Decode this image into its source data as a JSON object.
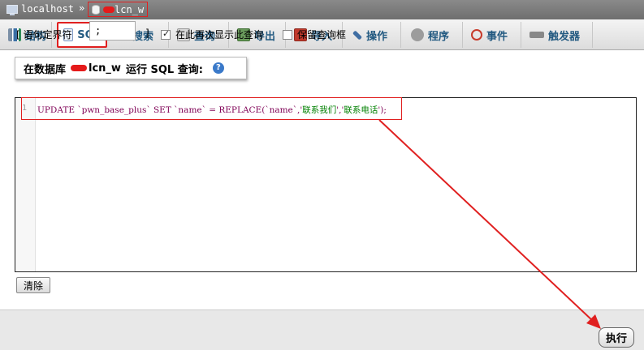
{
  "breadcrumb": {
    "server": "localhost",
    "separator": "»",
    "database": "lcn_w"
  },
  "tabs": [
    {
      "label": "结构",
      "icon": "structure-icon"
    },
    {
      "label": "SQL",
      "icon": "sql-icon"
    },
    {
      "label": "搜索",
      "icon": "search-icon"
    },
    {
      "label": "查询",
      "icon": "query-icon"
    },
    {
      "label": "导出",
      "icon": "export-icon"
    },
    {
      "label": "导入",
      "icon": "import-icon"
    },
    {
      "label": "操作",
      "icon": "wrench-icon"
    },
    {
      "label": "程序",
      "icon": "routines-icon"
    },
    {
      "label": "事件",
      "icon": "clock-icon"
    },
    {
      "label": "触发器",
      "icon": "triggers-icon"
    }
  ],
  "query_header": {
    "prefix": "在数据库",
    "database": "lcn_w",
    "suffix": "运行 SQL 查询:"
  },
  "editor": {
    "line_number": "1",
    "line": {
      "p1": "UPDATE `pwn_base_plus` SET `name` = REPLACE(`name`,'",
      "s1": "联系我们",
      "p2": "','",
      "s2": "联系电话",
      "p3": "');"
    }
  },
  "buttons": {
    "clear": "清除",
    "go": "执行"
  },
  "options": {
    "delimiter_label_open": "[ 语句定界符",
    "delimiter_value": ";",
    "delimiter_label_close": "]",
    "show_again": "在此再次显示此查询",
    "keep_box": "保留查询框"
  },
  "annotation_color": "#e02020"
}
